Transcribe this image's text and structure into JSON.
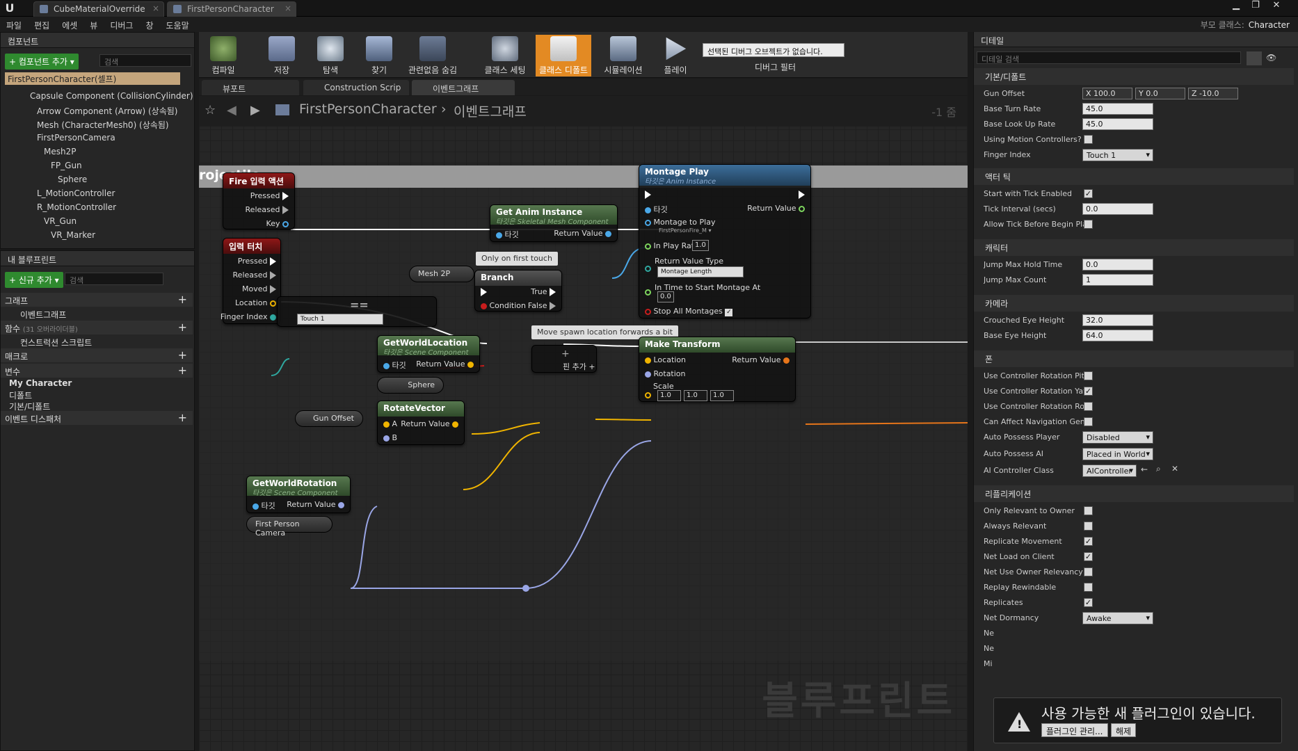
{
  "window": {
    "tabs": [
      "CubeMaterialOverride",
      "FirstPersonCharacter"
    ],
    "parent_class_label": "부모 클래스:",
    "parent_class_value": "Character"
  },
  "menu": [
    "파일",
    "편집",
    "에셋",
    "뷰",
    "디버그",
    "창",
    "도움말"
  ],
  "components": {
    "title": "컴포넌트",
    "add_label": "+ 컴포넌트 추가 ▾",
    "search_placeholder": "검색",
    "items": [
      "FirstPersonCharacter(셀프)",
      "Capsule Component (CollisionCylinder)",
      "Arrow Component (Arrow) (상속됨)",
      "Mesh (CharacterMesh0) (상속됨)",
      "FirstPersonCamera",
      "Mesh2P",
      "FP_Gun",
      "Sphere",
      "L_MotionController",
      "R_MotionController",
      "VR_Gun",
      "VR_Marker"
    ]
  },
  "myblueprint": {
    "title": "내 블루프린트",
    "add_label": "+ 신규 추가 ▾",
    "search_placeholder": "검색",
    "graph": "그래프",
    "eventgraph": "이벤트그래프",
    "functions": "함수",
    "functions_note": "(31 오버라이더블)",
    "construction": "컨스트럭션 스크립트",
    "macro": "매크로",
    "variables": "변수",
    "my_character": "My Character",
    "default": "디폴트",
    "basic_default": "기본/디폴트",
    "dispatcher": "이벤트 디스패처"
  },
  "toolbar": {
    "buttons": [
      "컴파일",
      "저장",
      "탐색",
      "찾기",
      "관련없음 숨김",
      "클래스 세팅",
      "클래스 디폴트",
      "시뮬레이션",
      "플레이"
    ],
    "debug_select": "선택된 디버그 오브젝트가 없습니다.",
    "debug_filter": "디버그 필터"
  },
  "editor_tabs": [
    "뷰포트",
    "Construction Scrip",
    "이벤트그래프"
  ],
  "graph": {
    "breadcrumb_bp": "FirstPersonCharacter",
    "breadcrumb_graph": "이벤트그래프",
    "zoom": "-1 줌",
    "comment": "rojectile",
    "watermark": "블루프린트",
    "fire": {
      "title": "Fire 입력 액션",
      "pins": [
        "Pressed",
        "Released",
        "Key"
      ]
    },
    "touch": {
      "title": "입력 터치",
      "pins": [
        "Pressed",
        "Released",
        "Moved",
        "Location",
        "Finger Index"
      ]
    },
    "eq": {
      "symbol": "==",
      "dropdown": "Touch 1"
    },
    "getanim": {
      "title": "Get Anim Instance",
      "sub": "타깃은 Skeletal Mesh Component",
      "target": "타깃",
      "ret": "Return Value"
    },
    "mesh2p": "Mesh 2P",
    "first_touch": "Only on first touch",
    "branch": {
      "title": "Branch",
      "cond": "Condition",
      "t": "True",
      "f": "False"
    },
    "montage": {
      "title": "Montage Play",
      "sub": "타깃은 Anim Instance",
      "target": "타깃",
      "ret": "Return Value",
      "mtp": "Montage to Play",
      "mtp_val": "FirstPersonFire_M ▾",
      "rate": "In Play Rate",
      "rate_val": "1.0",
      "rvt": "Return Value Type",
      "rvt_val": "Montage Length",
      "time": "In Time to Start Montage At",
      "time_val": "0.0",
      "stop": "Stop All Montages"
    },
    "move_spawn": "Move spawn location forwards a bit",
    "getworldloc": {
      "title": "GetWorldLocation",
      "sub": "타깃은 Scene Component",
      "target": "타깃",
      "ret": "Return Value"
    },
    "sphere": "Sphere",
    "add": {
      "label": "핀 추가",
      "symbol": "+"
    },
    "maketransform": {
      "title": "Make Transform",
      "loc": "Location",
      "rot": "Rotation",
      "scale": "Scale",
      "ret": "Return Value",
      "x": "1.0",
      "y": "1.0",
      "z": "1.0"
    },
    "rotate": {
      "title": "RotateVector",
      "a": "A",
      "b": "B",
      "ret": "Return Value"
    },
    "gunoffset": "Gun Offset",
    "getworldrot": {
      "title": "GetWorldRotation",
      "sub": "타깃은 Scene Component",
      "target": "타깃",
      "ret": "Return Value"
    },
    "fpcamera": "First Person Camera"
  },
  "details": {
    "title": "디테일",
    "search_placeholder": "디테일 검색",
    "cat_basic": "기본/디폴트",
    "cat_tick": "액터 틱",
    "cat_char": "캐릭터",
    "cat_cam": "카메라",
    "cat_pawn": "폰",
    "cat_rep": "리플리케이션",
    "gun_offset": {
      "label": "Gun Offset",
      "x": "X 100.0",
      "y": "Y 0.0",
      "z": "Z -10.0"
    },
    "rows_basic": [
      {
        "label": "Base Turn Rate",
        "value": "45.0"
      },
      {
        "label": "Base Look Up Rate",
        "value": "45.0"
      }
    ],
    "using_mc": "Using Motion Controllers?",
    "finger_index": {
      "label": "Finger Index",
      "value": "Touch 1"
    },
    "start_tick": "Start with Tick Enabled",
    "tick_interval": {
      "label": "Tick Interval (secs)",
      "value": "0.0"
    },
    "allow_tick": "Allow Tick Before Begin Pla",
    "jump_hold": {
      "label": "Jump Max Hold Time",
      "value": "0.0"
    },
    "jump_count": {
      "label": "Jump Max Count",
      "value": "1"
    },
    "crouched": {
      "label": "Crouched Eye Height",
      "value": "32.0"
    },
    "base_eye": {
      "label": "Base Eye Height",
      "value": "64.0"
    },
    "pawn_checks": [
      {
        "label": "Use Controller Rotation Pitc",
        "checked": false
      },
      {
        "label": "Use Controller Rotation Yaw",
        "checked": true
      },
      {
        "label": "Use Controller Rotation Roll",
        "checked": false
      },
      {
        "label": "Can Affect Navigation Gene",
        "checked": false
      }
    ],
    "auto_player": {
      "label": "Auto Possess Player",
      "value": "Disabled"
    },
    "auto_ai": {
      "label": "Auto Possess AI",
      "value": "Placed in World"
    },
    "ai_class": {
      "label": "AI Controller Class",
      "value": "AIController"
    },
    "rep_checks": [
      {
        "label": "Only Relevant to Owner",
        "checked": false
      },
      {
        "label": "Always Relevant",
        "checked": false
      },
      {
        "label": "Replicate Movement",
        "checked": true
      },
      {
        "label": "Net Load on Client",
        "checked": true
      },
      {
        "label": "Net Use Owner Relevancy",
        "checked": false
      },
      {
        "label": "Replay Rewindable",
        "checked": false
      },
      {
        "label": "Replicates",
        "checked": true
      }
    ],
    "net_dormancy": {
      "label": "Net Dormancy",
      "value": "Awake"
    },
    "trunc": [
      "Ne",
      "Ne",
      "Mi"
    ]
  },
  "notification": {
    "text": "사용 가능한 새 플러그인이 있습니다.",
    "manage": "플러그인 관리...",
    "dismiss": "해제"
  }
}
